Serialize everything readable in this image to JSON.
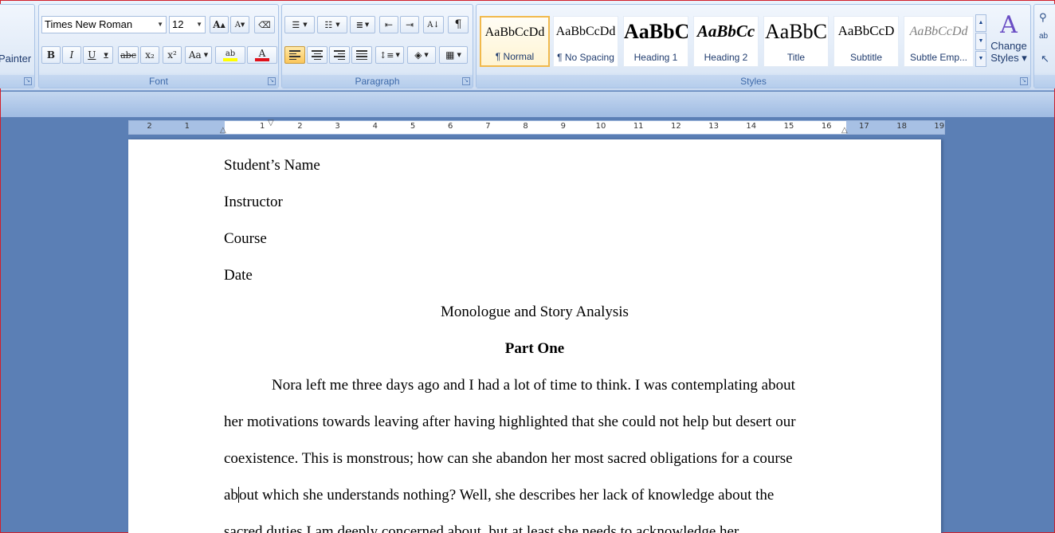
{
  "ribbon": {
    "clipboard": {
      "format_painter_label": "Painter"
    },
    "font": {
      "group_label": "Font",
      "font_name": "Times New Roman",
      "font_size": "12",
      "grow_label": "A",
      "shrink_label": "A",
      "bold_label": "B",
      "italic_label": "I",
      "underline_label": "U",
      "strike_label": "abc",
      "subscript_label": "x₂",
      "superscript_label": "x²",
      "case_label": "Aa",
      "highlight_label": "ab",
      "font_color_label": "A",
      "highlight_color": "#ffff00",
      "font_color": "#e0101a"
    },
    "paragraph": {
      "group_label": "Paragraph",
      "pilcrow_label": "¶"
    },
    "styles": {
      "group_label": "Styles",
      "tiles": [
        {
          "sample": "AaBbCcDd",
          "name": "¶ Normal"
        },
        {
          "sample": "AaBbCcDd",
          "name": "¶ No Spacing"
        },
        {
          "sample": "AaBbC",
          "name": "Heading 1"
        },
        {
          "sample": "AaBbCc",
          "name": "Heading 2"
        },
        {
          "sample": "AaBbC",
          "name": "Title"
        },
        {
          "sample": "AaBbCcD",
          "name": "Subtitle"
        },
        {
          "sample": "AaBbCcDd",
          "name": "Subtle Emp..."
        }
      ],
      "change_styles_line1": "Change",
      "change_styles_line2": "Styles ▾"
    }
  },
  "ruler": {
    "numbers": [
      "2",
      "1",
      "1",
      "2",
      "3",
      "4",
      "5",
      "6",
      "7",
      "8",
      "9",
      "10",
      "11",
      "12",
      "13",
      "14",
      "15",
      "16",
      "17",
      "18",
      "19"
    ]
  },
  "document": {
    "header_lines": [
      "Student’s Name",
      "Instructor",
      "Course",
      "Date"
    ],
    "title": "Monologue and Story Analysis",
    "part": "Part One",
    "para_line1": "Nora left me three days ago and I had a lot of time to think. I was contemplating about",
    "para_line2": "her motivations towards leaving after having highlighted that she could not help but desert our",
    "para_line3": "coexistence. This is monstrous; how can she abandon her most sacred obligations for a course",
    "para_line4_a": "ab",
    "para_line4_b": "out which she understands nothing? Well, she describes her lack of knowledge about the",
    "para_line5": "sacred duties I am deeply concerned about, but at least she needs to acknowledge her"
  }
}
